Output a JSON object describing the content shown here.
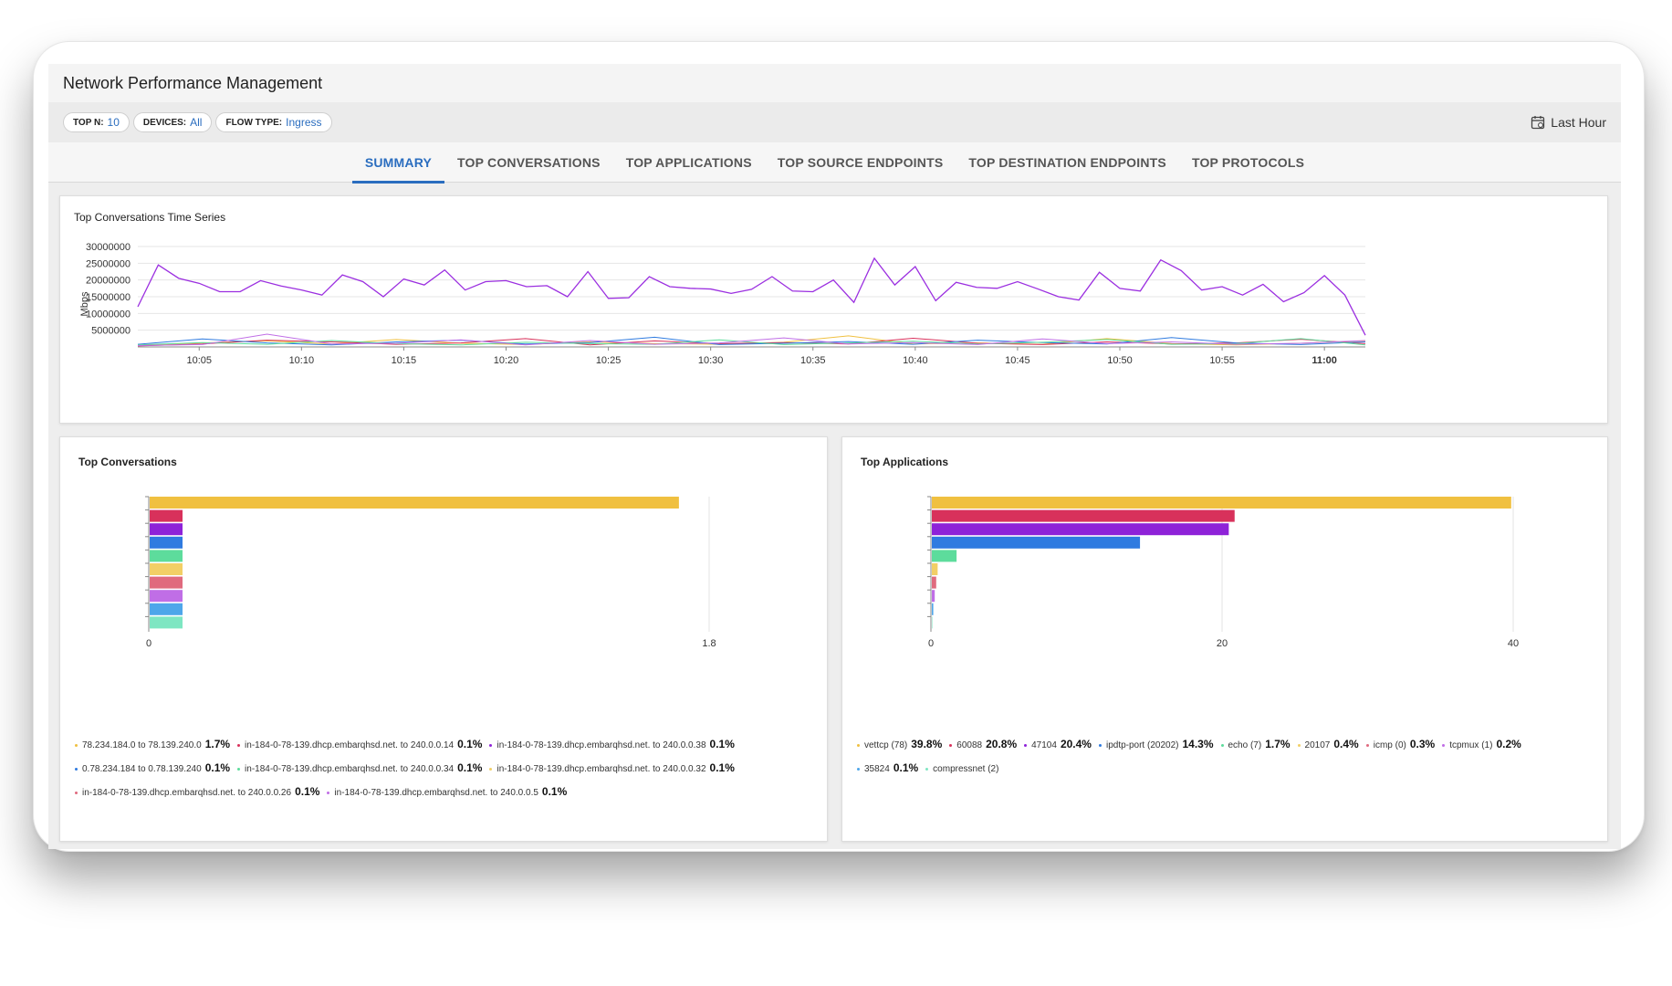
{
  "app": {
    "title": "Network Performance Management"
  },
  "filters": [
    {
      "key": "TOP N:",
      "value": "10"
    },
    {
      "key": "DEVICES:",
      "value": "All"
    },
    {
      "key": "FLOW TYPE:",
      "value": "Ingress"
    }
  ],
  "time_range": {
    "label": "Last Hour",
    "icon": "calendar-icon"
  },
  "tabs": [
    {
      "label": "SUMMARY",
      "active": true
    },
    {
      "label": "TOP CONVERSATIONS",
      "active": false
    },
    {
      "label": "TOP APPLICATIONS",
      "active": false
    },
    {
      "label": "TOP SOURCE ENDPOINTS",
      "active": false
    },
    {
      "label": "TOP DESTINATION ENDPOINTS",
      "active": false
    },
    {
      "label": "TOP PROTOCOLS",
      "active": false
    }
  ],
  "colors": {
    "accent": "#2a6dbf",
    "purple_line": "#9b2fe0",
    "series": [
      "#f0c040",
      "#d8315b",
      "#8e22d8",
      "#2f7be0",
      "#5ddc9c",
      "#f2cf66",
      "#e06a7e",
      "#c06ee6",
      "#4ea6ea",
      "#7ee6c2"
    ]
  },
  "chart_data": [
    {
      "type": "line",
      "title": "Top Conversations Time Series",
      "ylabel": "Mbps",
      "ylim": [
        0,
        30000000
      ],
      "yticks": [
        "30000000",
        "25000000",
        "20000000",
        "15000000",
        "10000000",
        "5000000"
      ],
      "xticks": [
        "10:05",
        "10:10",
        "10:15",
        "10:20",
        "10:25",
        "10:30",
        "10:35",
        "10:40",
        "10:45",
        "10:50",
        "10:55",
        "11:00"
      ],
      "grid": true,
      "series": [
        {
          "color": "#9b2fe0",
          "x_minutes": [
            2,
            3,
            4,
            5,
            6,
            7,
            8,
            9,
            10,
            11,
            12,
            13,
            14,
            15,
            16,
            17,
            18,
            19,
            20,
            21,
            22,
            23,
            24,
            25,
            26,
            27,
            28,
            29,
            30,
            31,
            32,
            33,
            34,
            35,
            36,
            37,
            38,
            39,
            40,
            41,
            42,
            43,
            44,
            45,
            46,
            47,
            48,
            49,
            50,
            51,
            52,
            53,
            54,
            55,
            56,
            57,
            58,
            59,
            60,
            61,
            62
          ],
          "values": [
            12000000,
            24500000,
            20500000,
            19000000,
            16500000,
            16500000,
            19800000,
            18200000,
            17000000,
            15500000,
            21500000,
            19500000,
            15000000,
            20300000,
            18500000,
            23000000,
            17000000,
            19500000,
            19800000,
            18000000,
            18300000,
            15000000,
            22500000,
            14500000,
            14700000,
            21000000,
            18000000,
            17500000,
            17300000,
            16000000,
            17200000,
            21000000,
            16700000,
            16500000,
            20000000,
            13300000,
            26500000,
            18500000,
            24000000,
            13800000,
            19300000,
            17800000,
            17500000,
            19500000,
            17300000,
            15000000,
            14000000,
            22300000,
            17500000,
            16700000,
            26000000,
            22800000,
            17000000,
            18000000,
            15500000,
            18700000,
            13500000,
            16200000,
            21300000,
            15500000,
            3500000
          ]
        },
        {
          "color": "#f0c040",
          "label_note": "low-level series",
          "values": [
            500000,
            1200000,
            1800000,
            900000,
            2200000,
            1100000,
            700000,
            1500000,
            1000000,
            800000,
            1400000,
            3300000,
            900000,
            1200000,
            800000,
            2500000,
            1000000,
            600000,
            1100000,
            1800000
          ]
        },
        {
          "color": "#d8315b",
          "values": [
            300000,
            900000,
            2000000,
            1500000,
            800000,
            1200000,
            2500000,
            600000,
            1800000,
            1000000,
            1300000,
            900000,
            2600000,
            1100000,
            700000,
            1500000,
            900000,
            1200000,
            2300000,
            1000000
          ]
        },
        {
          "color": "#2f7be0",
          "values": [
            800000,
            2400000,
            1200000,
            600000,
            1500000,
            2000000,
            900000,
            1300000,
            2900000,
            700000,
            1100000,
            1600000,
            800000,
            2000000,
            1300000,
            900000,
            2800000,
            1200000,
            700000,
            1500000
          ]
        },
        {
          "color": "#5ddc9c",
          "values": [
            600000,
            1300000,
            800000,
            1900000,
            1000000,
            600000,
            1400000,
            1000000,
            800000,
            2100000,
            700000,
            1200000,
            1700000,
            900000,
            1400000,
            2200000,
            800000,
            1000000,
            2500000,
            600000
          ]
        },
        {
          "color": "#c06ee6",
          "values": [
            400000,
            700000,
            3800000,
            900000,
            1100000,
            2100000,
            600000,
            1900000,
            800000,
            1200000,
            2700000,
            900000,
            1300000,
            700000,
            2400000,
            1000000,
            1500000,
            800000,
            1100000,
            1900000
          ]
        }
      ]
    },
    {
      "type": "bar",
      "orientation": "horizontal",
      "title": "Top Conversations",
      "xlim": [
        0,
        1.8
      ],
      "xticks": [
        "0",
        "1.8"
      ],
      "categories": [
        "78.234.184.0 to 78.139.240.0",
        "in-184-0-78-139.dhcp.embarqhsd.net. to 240.0.0.14",
        "in-184-0-78-139.dhcp.embarqhsd.net. to 240.0.0.38",
        "0.78.234.184 to 0.78.139.240",
        "in-184-0-78-139.dhcp.embarqhsd.net. to 240.0.0.34",
        "in-184-0-78-139.dhcp.embarqhsd.net. to 240.0.0.32",
        "in-184-0-78-139.dhcp.embarqhsd.net. to 240.0.0.26",
        "in-184-0-78-139.dhcp.embarqhsd.net. to 240.0.0.5",
        "",
        ""
      ],
      "values": [
        1.7,
        0.1,
        0.1,
        0.1,
        0.1,
        0.1,
        0.1,
        0.1,
        0.1,
        0.1
      ],
      "colors": [
        "#f0c040",
        "#d8315b",
        "#8e22d8",
        "#2f7be0",
        "#5ddc9c",
        "#f2cf66",
        "#e06a7e",
        "#c06ee6",
        "#4ea6ea",
        "#7ee6c2"
      ],
      "legend": [
        {
          "label": "78.234.184.0 to 78.139.240.0",
          "pct": "1.7%",
          "color": "#f0c040"
        },
        {
          "label": "in-184-0-78-139.dhcp.embarqhsd.net. to 240.0.0.14",
          "pct": "0.1%",
          "color": "#d8315b"
        },
        {
          "label": "in-184-0-78-139.dhcp.embarqhsd.net. to 240.0.0.38",
          "pct": "0.1%",
          "color": "#8e22d8"
        },
        {
          "label": "0.78.234.184 to 0.78.139.240",
          "pct": "0.1%",
          "color": "#2f7be0"
        },
        {
          "label": "in-184-0-78-139.dhcp.embarqhsd.net. to 240.0.0.34",
          "pct": "0.1%",
          "color": "#5ddc9c"
        },
        {
          "label": "in-184-0-78-139.dhcp.embarqhsd.net. to 240.0.0.32",
          "pct": "0.1%",
          "color": "#f2cf66"
        },
        {
          "label": "in-184-0-78-139.dhcp.embarqhsd.net. to 240.0.0.26",
          "pct": "0.1%",
          "color": "#e06a7e"
        },
        {
          "label": "in-184-0-78-139.dhcp.embarqhsd.net. to 240.0.0.5",
          "pct": "0.1%",
          "color": "#c06ee6"
        }
      ]
    },
    {
      "type": "bar",
      "orientation": "horizontal",
      "title": "Top Applications",
      "xlim": [
        0,
        40
      ],
      "xticks": [
        "0",
        "20",
        "40"
      ],
      "categories": [
        "vettcp (78)",
        "60088",
        "47104",
        "ipdtp-port (20202)",
        "echo (7)",
        "20107",
        "icmp (0)",
        "tcpmux (1)",
        "35824",
        "compressnet (2)"
      ],
      "values": [
        39.8,
        20.8,
        20.4,
        14.3,
        1.7,
        0.4,
        0.3,
        0.2,
        0.1,
        0
      ],
      "colors": [
        "#f0c040",
        "#d8315b",
        "#8e22d8",
        "#2f7be0",
        "#5ddc9c",
        "#f2cf66",
        "#e06a7e",
        "#c06ee6",
        "#4ea6ea",
        "#7ee6c2"
      ],
      "legend": [
        {
          "label": "vettcp (78)",
          "pct": "39.8%",
          "color": "#f0c040"
        },
        {
          "label": "60088",
          "pct": "20.8%",
          "color": "#d8315b"
        },
        {
          "label": "47104",
          "pct": "20.4%",
          "color": "#8e22d8"
        },
        {
          "label": "ipdtp-port (20202)",
          "pct": "14.3%",
          "color": "#2f7be0"
        },
        {
          "label": "echo (7)",
          "pct": "1.7%",
          "color": "#5ddc9c"
        },
        {
          "label": "20107",
          "pct": "0.4%",
          "color": "#f2cf66"
        },
        {
          "label": "icmp (0)",
          "pct": "0.3%",
          "color": "#e06a7e"
        },
        {
          "label": "tcpmux (1)",
          "pct": "0.2%",
          "color": "#c06ee6"
        },
        {
          "label": "35824",
          "pct": "0.1%",
          "color": "#4ea6ea"
        },
        {
          "label": "compressnet (2)",
          "pct": "",
          "color": "#7ee6c2"
        }
      ]
    }
  ]
}
